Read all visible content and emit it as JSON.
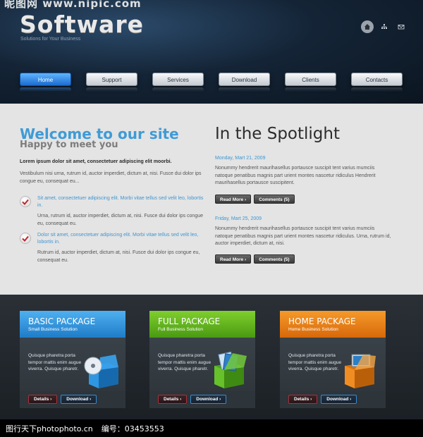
{
  "watermark_top": "昵图网 www.nipic.com",
  "header": {
    "logo": "Software",
    "tagline": "Solutions for Your Business",
    "icons": [
      "home-icon",
      "sitemap-icon",
      "mail-icon"
    ]
  },
  "nav": {
    "items": [
      "Home",
      "Support",
      "Services",
      "Download",
      "Clients",
      "Contacts"
    ],
    "active": "Home"
  },
  "welcome": {
    "title": "Welcome to our site",
    "subtitle": "Happy to meet you",
    "lead": "Lorem ipsum dolor sit amet, consectetuer adipiscing elit moorbi.",
    "paragraph": "Vestibulum nisi urna, rutrum id, auctor imperdiet, dictum at, nisi. Fusce dui dolor ips congue eu, consequat eu...",
    "items": [
      {
        "title": "Sit amet, consectetuer adipiscing elit. Morbi vitae tellus sed velit leo, lobortis in.",
        "text": "Urna, rutrum id, auctor imperdiet, dictum at, nisi. Fusce dui dolor ips congue eu, consequat eu."
      },
      {
        "title": "Dolor sit amet, consectetuer adipiscing elit. Morbi vitae tellus sed velit leo, lobortis in.",
        "text": "Rutrum id, auctor imperdiet, dictum at, nisi. Fusce dui dolor ips congue eu, consequat eu."
      }
    ]
  },
  "spotlight": {
    "title": "In the Spotlight",
    "items": [
      {
        "date": "Monday, Mart 21, 2009",
        "text": "Nonummy hendrerit maurihasellus portausce suscipit tent varius mumciis natoque penatibus magnis part urient montes nascetur ridiculus Hendrerit maurihasellus portausce suscipitent.",
        "read_more": "Read More ›",
        "comments": "Comments (5)"
      },
      {
        "date": "Friday, Mart 25, 2009",
        "text": "Nonummy hendrerit maurihasellus portausce suscipit tent varius mumciis natoque penatibus magnis part urient montes nascetur ridiculus. Urna, rutrum id, auctor imperdiet, dictum at, nisi.",
        "read_more": "Read More ›",
        "comments": "Comments (5)"
      }
    ]
  },
  "packages": [
    {
      "title": "BASIC PACKAGE",
      "subtitle": "Small Business Solution",
      "description": "Quisque pharetra porta tempor mattis enim augue viverra. Quisque pharetr.",
      "details": "Details ›",
      "download": "Download ›",
      "color": "#2f8fd8"
    },
    {
      "title": "FULL PACKAGE",
      "subtitle": "Full Business Solution",
      "description": "Quisque pharetra porta tempor mattis enim augue viverra. Quisque pharetr.",
      "details": "Details ›",
      "download": "Download ›",
      "color": "#5aab1f"
    },
    {
      "title": "HOME PACKAGE",
      "subtitle": "Home Business Solution",
      "description": "Quisque pharetra porta tempor mattis enim augue viverra. Quisque pharetr.",
      "details": "Details ›",
      "download": "Download ›",
      "color": "#e47d13"
    }
  ],
  "watermark_bottom": {
    "site": "图行天下photophoto.cn",
    "code": "编号：03453553"
  }
}
